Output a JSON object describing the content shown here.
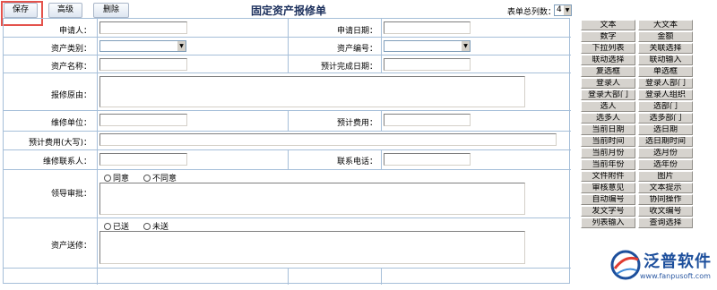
{
  "toolbar": {
    "save": "保存",
    "advanced": "高级",
    "delete": "删除"
  },
  "form": {
    "title": "固定资产报修单",
    "col_count_label": "表单总列数：",
    "col_count_value": "4",
    "labels": {
      "applicant": "申请人：",
      "apply_date": "申请日期：",
      "asset_category": "资产类别：",
      "asset_code": "资产编号：",
      "asset_name": "资产名称：",
      "expected_finish_date": "预计完成日期：",
      "repair_reason": "报修原由：",
      "repair_unit": "维修单位：",
      "estimated_cost": "预计费用：",
      "estimated_cost_upper": "预计费用(大写)：",
      "repair_contact": "维修联系人：",
      "contact_phone": "联系电话：",
      "leader_approval": "领导审批：",
      "asset_delivery": "资产送修："
    },
    "approval_options": [
      "同意",
      "不同意"
    ],
    "delivery_options": [
      "已送",
      "未送"
    ]
  },
  "palette": [
    [
      "文本",
      "大文本"
    ],
    [
      "数字",
      "金额"
    ],
    [
      "下拉列表",
      "关联选择"
    ],
    [
      "联动选择",
      "联动输入"
    ],
    [
      "复选框",
      "单选框"
    ],
    [
      "登录人",
      "登录人部门"
    ],
    [
      "登录大部门",
      "登录人组织"
    ],
    [
      "选人",
      "选部门"
    ],
    [
      "选多人",
      "选多部门"
    ],
    [
      "当前日期",
      "选日期"
    ],
    [
      "当前时间",
      "选日期时间"
    ],
    [
      "当前月份",
      "选月份"
    ],
    [
      "当前年份",
      "选年份"
    ],
    [
      "文件附件",
      "图片"
    ],
    [
      "审核意见",
      "文本提示"
    ],
    [
      "自动编号",
      "协同操作"
    ],
    [
      "发文字号",
      "收文编号"
    ],
    [
      "列表输入",
      "查询选择"
    ]
  ],
  "logo": {
    "name": "泛普软件",
    "url": "www.fanpusoft.com",
    "color": "#1d4f9c"
  }
}
